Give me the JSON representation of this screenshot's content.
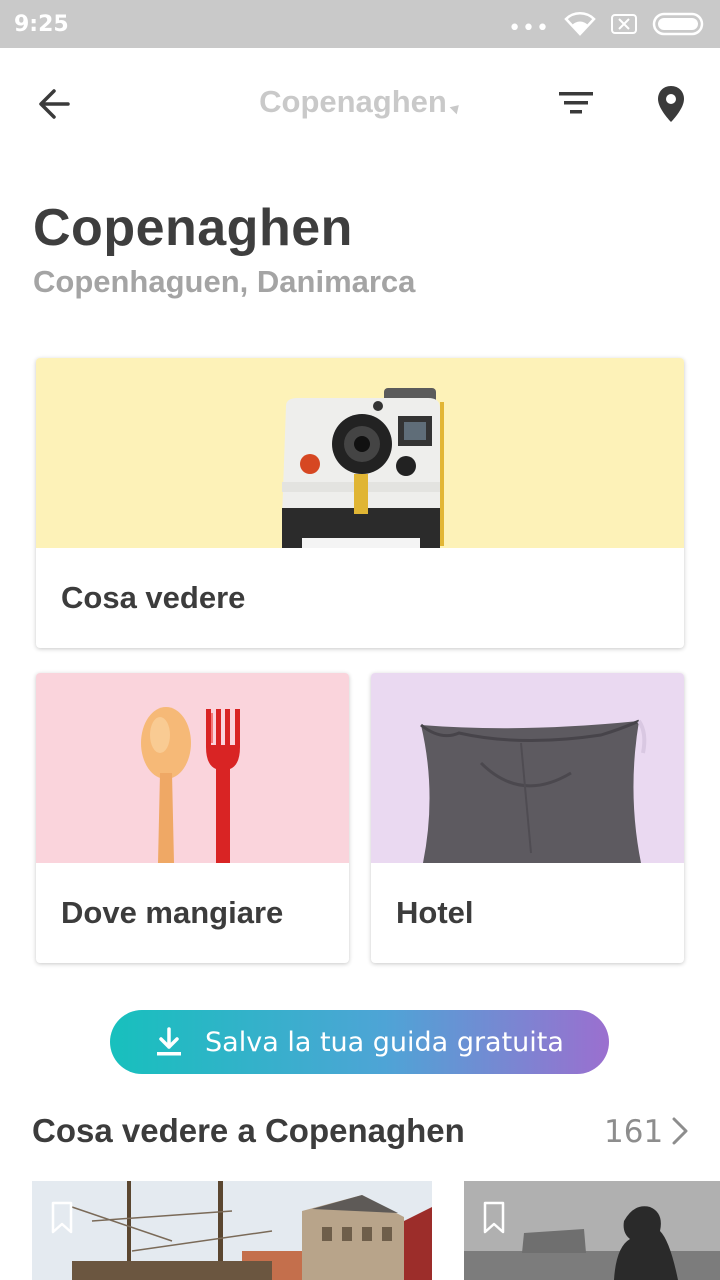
{
  "status_bar": {
    "time": "9:25",
    "dots": "•••",
    "icons": [
      "wifi-icon",
      "sim-x-icon",
      "battery-icon"
    ]
  },
  "header": {
    "title": "Copenaghen",
    "icons": [
      "back-arrow-icon",
      "filter-icon",
      "map-pin-icon"
    ]
  },
  "page": {
    "title": "Copenaghen",
    "subtitle": "Copenhaguen, Danimarca"
  },
  "cards": {
    "see": {
      "label": "Cosa vedere",
      "image": "polaroid-camera",
      "bg": "#fdf2b8"
    },
    "eat": {
      "label": "Dove mangiare",
      "image": "spoon-fork",
      "bg": "#fad4dc"
    },
    "hotel": {
      "label": "Hotel",
      "image": "pillow",
      "bg": "#ead9f1"
    }
  },
  "cta": {
    "label": "Salva la tua guida gratuita",
    "icon": "download-icon",
    "gradient": [
      "#17c0bd",
      "#9b6fcf"
    ]
  },
  "section": {
    "title": "Cosa vedere a Copenaghen",
    "count": "161",
    "chevron": "chevron-right-icon"
  },
  "places": [
    {
      "image": "nyhavn-harbor-photo",
      "icon": "bookmark-icon"
    },
    {
      "image": "little-mermaid-photo",
      "icon": "bookmark-icon"
    }
  ]
}
